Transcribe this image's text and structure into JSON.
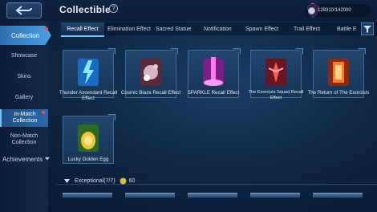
{
  "header": {
    "title": "Collectible",
    "currency_value": "129310/142000"
  },
  "sidebar": {
    "main": "Collection",
    "items": [
      {
        "label": "Showcase"
      },
      {
        "label": "Skins"
      },
      {
        "label": "Gallery"
      },
      {
        "label": "In-Match Collection"
      },
      {
        "label": "Non-Match Collection"
      }
    ],
    "achievements": "Achievements"
  },
  "tabs": [
    {
      "label": "Recall Effect"
    },
    {
      "label": "Elimination Effect"
    },
    {
      "label": "Sacred Statue"
    },
    {
      "label": "Notification"
    },
    {
      "label": "Spawn Effect"
    },
    {
      "label": "Trail Effect"
    },
    {
      "label": "Battle E"
    }
  ],
  "items": [
    {
      "label": "Thunder Ascendant Recall Effect"
    },
    {
      "label": "Cosmic Blaze Recall Effect"
    },
    {
      "label": "SPARKLE Recall Effect"
    },
    {
      "label": "The Exorcists Squad Recall Effect"
    },
    {
      "label": "The Return of The Exorcists"
    },
    {
      "label": "Lucky Golden Egg"
    }
  ],
  "section": {
    "label": "Exceptional(7/7)",
    "points": "60"
  },
  "colors": {
    "accent": "#4aa0e6",
    "selected_tab_underline": "#6dc4ff"
  }
}
